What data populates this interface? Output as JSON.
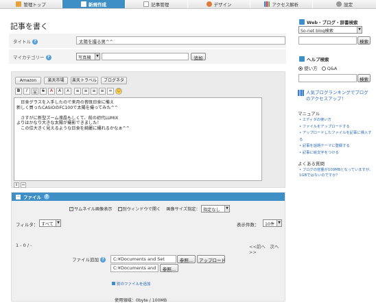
{
  "nav": {
    "tabs": [
      {
        "label": "管理トップ",
        "icon": "home-icon"
      },
      {
        "label": "新規作成",
        "icon": "edit-icon"
      },
      {
        "label": "記事管理",
        "icon": "document-icon"
      },
      {
        "label": "デザイン",
        "icon": "palette-icon"
      },
      {
        "label": "アクセス解析",
        "icon": "bar-chart-icon"
      },
      {
        "label": "設定",
        "icon": "gear-icon"
      }
    ],
    "active_index": 1
  },
  "page_title": "記事を書く",
  "form": {
    "title_label": "タイトル",
    "title_value": "太陽を撮る男^^",
    "category_label": "マイカテゴリー",
    "category_value": "写真機",
    "category_add_button": "追加"
  },
  "editor": {
    "tabs": [
      "Amazon",
      "楽天市場",
      "楽天トラベル",
      "ブログネタ"
    ],
    "toolbar": [
      "B",
      "I",
      "U",
      "S",
      "A",
      "A",
      "A",
      "≡",
      "≡",
      "≡",
      "≡",
      "∞",
      "☺"
    ],
    "body": "　日食グラスを入手したので来月の皆既日食に備え\n新しく買ったCASIOのFC100で太陽を撮ってみた^^\n\n　さすがに新型ズーム液晶もしくて、前の初代LUMIX\nよりはかなり大きな太陽が撮影できました！\n　この位大きく見えるような日食を綺麗に撮れるかなぁ^^"
  },
  "files": {
    "header": "ファイル",
    "thumb_option": "サムネイル画像表示",
    "new_window_option": "別ウィンドウで開く",
    "size_label": "画像サイズ指定：",
    "size_value": "指定なし",
    "filter_label": "フィルタ：",
    "filter_value": "すべて",
    "per_page_label": "表示件数：",
    "per_page_value": "10件",
    "count": "1 - 0 / -",
    "pager": "<<前へ　次へ>>",
    "add_label": "ファイル追加",
    "path1": "C:¥Documents and Set",
    "path2": "C:¥Documents and",
    "browse": "参照...",
    "upload": "アップロード",
    "more_files": "別のファイルを追加",
    "usage": "使用領域：0byte / 100MB"
  },
  "sidebar": {
    "search_title": "Web・ブログ・辞書検索",
    "search_select": "So-net blog検索",
    "search_button": "検索",
    "help_title": "ヘルプ検索",
    "radio1": "使い方",
    "radio2": "Q&A",
    "help_button": "検索",
    "ranking_link": "人気ブログランキングでブログのアクセスアップ！",
    "manual_title": "マニュアル",
    "manual_links": [
      "エディタの使い方",
      "ファイルをアップロードする",
      "アップロードしたファイルを記事に挿入する",
      "記事を話題テーマに登録する",
      "記事に絵文字をつける"
    ],
    "faq_title": "よくある質問",
    "faq_links": [
      "ブログの容量が100MBとなっていますが、1GBではないのですか？"
    ]
  }
}
